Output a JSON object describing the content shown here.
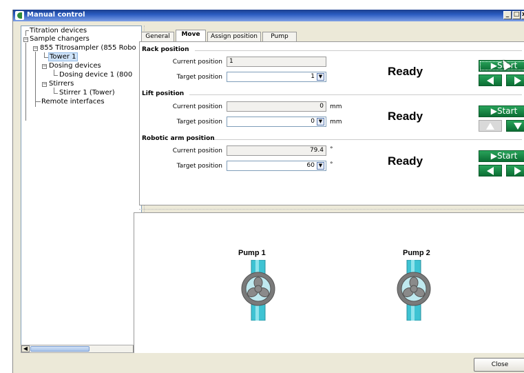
{
  "window": {
    "title": "Manual control",
    "minimize": "_",
    "maximize": "□",
    "close": "x"
  },
  "tree": {
    "items": [
      {
        "label": "Titration devices"
      },
      {
        "label": "Sample changers"
      },
      {
        "label": "855 Titrosampler (855 Robo"
      },
      {
        "label": "Tower 1"
      },
      {
        "label": "Dosing devices"
      },
      {
        "label": "Dosing device 1 (800"
      },
      {
        "label": "Stirrers"
      },
      {
        "label": "Stirrer 1 (Tower)"
      },
      {
        "label": "Remote interfaces"
      }
    ],
    "scroll_left": "◀",
    "scroll_right": "▶"
  },
  "tabs": [
    {
      "label": "General"
    },
    {
      "label": "Move"
    },
    {
      "label": "Assign position"
    },
    {
      "label": "Pump"
    }
  ],
  "rack": {
    "title": "Rack position",
    "current_label": "Current position",
    "current_value": "1",
    "target_label": "Target position",
    "target_value": "1",
    "status": "Ready",
    "start": "Start"
  },
  "lift": {
    "title": "Lift position",
    "current_label": "Current position",
    "current_value": "0",
    "current_unit": "mm",
    "target_label": "Target position",
    "target_value": "0",
    "target_unit": "mm",
    "status": "Ready",
    "start": "Start"
  },
  "arm": {
    "title": "Robotic arm position",
    "current_label": "Current position",
    "current_value": "79.4",
    "current_unit": "°",
    "target_label": "Target position",
    "target_value": "60",
    "target_unit": "°",
    "status": "Ready",
    "start": "Start"
  },
  "pumps": [
    {
      "label": "Pump 1"
    },
    {
      "label": "Pump 2"
    }
  ],
  "footer": {
    "close": "Close"
  },
  "colors": {
    "start_green": "#0f7a3a",
    "tube_cyan": "#3ec3d3",
    "title_blue": "#2a5bc0"
  }
}
